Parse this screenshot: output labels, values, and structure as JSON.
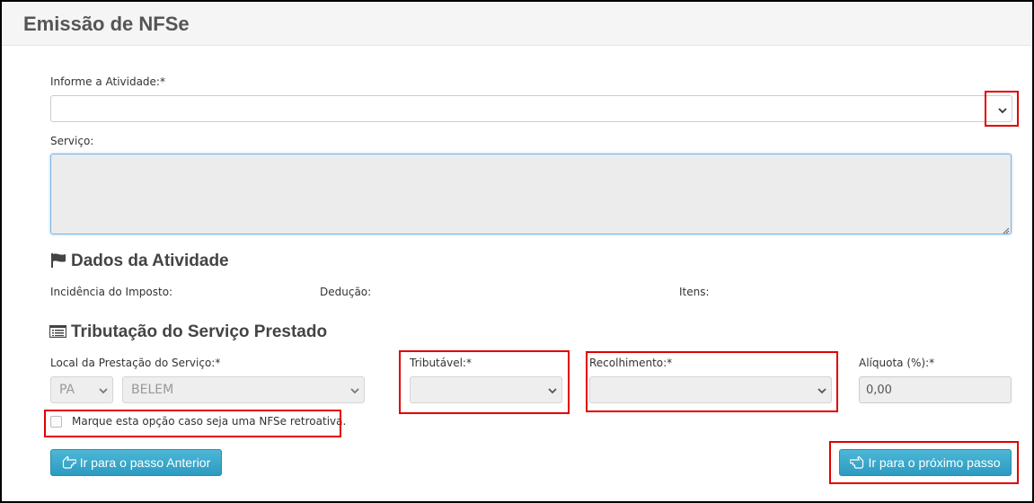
{
  "page": {
    "title": "Emissão de NFSe"
  },
  "atividade": {
    "label": "Informe a Atividade:*",
    "value": ""
  },
  "servico": {
    "label": "Serviço:",
    "value": ""
  },
  "dados_atividade": {
    "title": "Dados da Atividade",
    "incidencia_label": "Incidência do Imposto:",
    "deducao_label": "Dedução:",
    "itens_label": "Itens:"
  },
  "tributacao": {
    "title": "Tributação do Serviço Prestado",
    "local_label": "Local da Prestação do Serviço:*",
    "uf_value": "PA",
    "cidade_value": "BELEM",
    "tributavel_label": "Tributável:*",
    "tributavel_value": "",
    "recolhimento_label": "Recolhimento:*",
    "recolhimento_value": "",
    "aliquota_label": "Alíquota (%):*",
    "aliquota_value": "0,00",
    "retroativa_label": "Marque esta opção caso seja uma NFSe retroativa."
  },
  "buttons": {
    "anterior": "Ir para o passo Anterior",
    "proximo": "Ir para o próximo passo"
  },
  "colors": {
    "highlight": "#e00000",
    "button": "#31a2c9"
  },
  "icons": {
    "flag": "flag-icon",
    "list": "list-icon",
    "back": "hand-left-icon",
    "next": "hand-right-icon"
  }
}
